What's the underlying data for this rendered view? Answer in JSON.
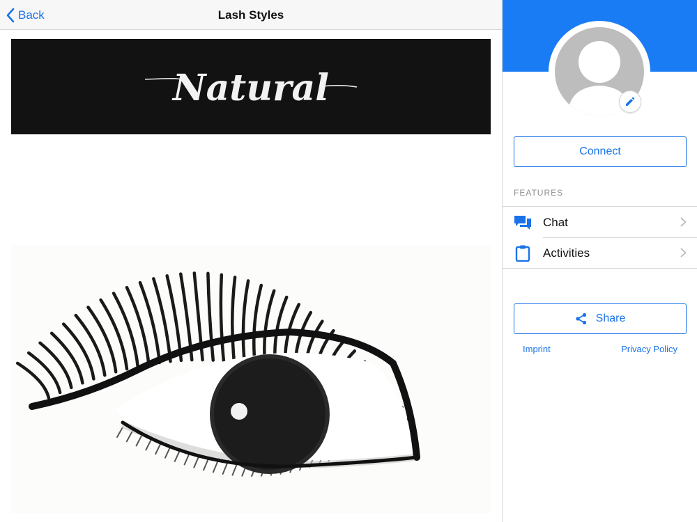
{
  "navbar": {
    "back_label": "Back",
    "title": "Lash Styles"
  },
  "content": {
    "banner_text": "Natural",
    "images": [
      "banner",
      "eye-illustration"
    ]
  },
  "sidebar": {
    "header_color": "#1a7cf5",
    "avatar_icon": "person-silhouette-icon",
    "edit_icon": "pencil-icon",
    "connect_label": "Connect",
    "features_heading": "FEATURES",
    "features": [
      {
        "label": "Chat",
        "icon": "chat-bubbles-icon"
      },
      {
        "label": "Activities",
        "icon": "clipboard-icon"
      }
    ],
    "share_label": "Share",
    "footer": {
      "imprint": "Imprint",
      "privacy": "Privacy Policy"
    }
  },
  "colors": {
    "accent": "#1a73e8",
    "banner_bg": "#121212",
    "divider": "#d6d6d6"
  }
}
